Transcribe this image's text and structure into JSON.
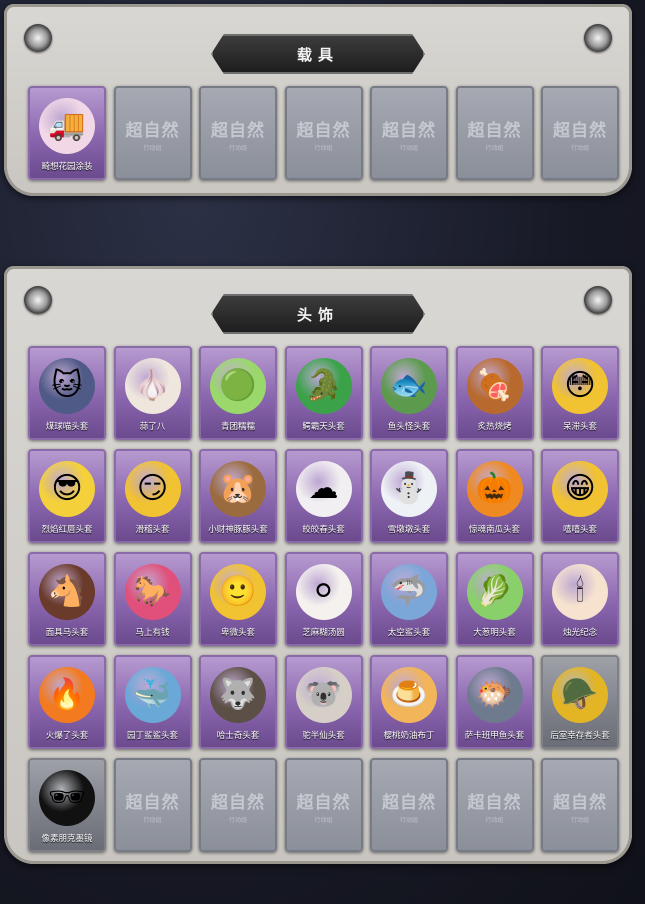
{
  "vehicle_section": {
    "title": "载具",
    "items": [
      {
        "label": "畸想花园涂装",
        "icon": "ice-cream-truck-icon",
        "glyph": "🚚",
        "rarity": "purple",
        "color": "#f2d8e6"
      }
    ],
    "empty_watermark": "超自然",
    "empty_watermark_sub": "行动组",
    "empty_count": 6
  },
  "headwear_section": {
    "title": "头饰",
    "items": [
      {
        "label": "煤球喵头套",
        "icon": "cat-head-icon",
        "glyph": "🐱",
        "rarity": "purple",
        "color": "#505a86"
      },
      {
        "label": "蒜了八",
        "icon": "garlic-head-icon",
        "glyph": "🧄",
        "rarity": "purple",
        "color": "#efe6dd"
      },
      {
        "label": "青团糯糯",
        "icon": "green-dumpling-icon",
        "glyph": "🟢",
        "rarity": "purple",
        "color": "#9ad86b"
      },
      {
        "label": "鳄霸天头套",
        "icon": "crocodile-head-icon",
        "glyph": "🐊",
        "rarity": "purple",
        "color": "#3ba24a"
      },
      {
        "label": "鱼头怪头套",
        "icon": "fish-head-icon",
        "glyph": "🐟",
        "rarity": "purple",
        "color": "#5c9a4e"
      },
      {
        "label": "炙热烧烤",
        "icon": "bbq-head-icon",
        "glyph": "🍖",
        "rarity": "purple",
        "color": "#b86a2e"
      },
      {
        "label": "呆滞头套",
        "icon": "dazed-emoji-icon",
        "glyph": "😳",
        "rarity": "purple",
        "color": "#f1c232"
      },
      {
        "label": "烈焰红唇头套",
        "icon": "pikachu-sunglasses-icon",
        "glyph": "😎",
        "rarity": "purple",
        "color": "#f4d13a"
      },
      {
        "label": "滑稽头套",
        "icon": "funny-emoji-icon",
        "glyph": "😏",
        "rarity": "purple",
        "color": "#f1c232"
      },
      {
        "label": "小财神豚豚头套",
        "icon": "capybara-head-icon",
        "glyph": "🐹",
        "rarity": "purple",
        "color": "#9a6b3e"
      },
      {
        "label": "皎皎春头套",
        "icon": "cloud-face-icon",
        "glyph": "☁",
        "rarity": "purple",
        "color": "#f2eff2"
      },
      {
        "label": "雪墩墩头套",
        "icon": "snowman-head-icon",
        "glyph": "⛄",
        "rarity": "purple",
        "color": "#eef2f6"
      },
      {
        "label": "惊魂南瓜头套",
        "icon": "pumpkin-head-icon",
        "glyph": "🎃",
        "rarity": "purple",
        "color": "#ef8a22"
      },
      {
        "label": "嘻嘻头套",
        "icon": "grin-emoji-icon",
        "glyph": "😁",
        "rarity": "purple",
        "color": "#f1c232"
      },
      {
        "label": "面具马头套",
        "icon": "horse-head-icon",
        "glyph": "🐴",
        "rarity": "purple",
        "color": "#6a3a2a"
      },
      {
        "label": "马上有钱",
        "icon": "pink-horse-head-icon",
        "glyph": "🐎",
        "rarity": "purple",
        "color": "#e0507a"
      },
      {
        "label": "卑微头套",
        "icon": "humble-emoji-icon",
        "glyph": "🙂",
        "rarity": "purple",
        "color": "#f1c232"
      },
      {
        "label": "芝麻糊汤圆",
        "icon": "rice-ball-head-icon",
        "glyph": "⚪",
        "rarity": "purple",
        "color": "#f4f1ee"
      },
      {
        "label": "太空鲨头套",
        "icon": "shark-head-icon",
        "glyph": "🦈",
        "rarity": "purple",
        "color": "#7aa6d8"
      },
      {
        "label": "大葱明头套",
        "icon": "scallion-head-icon",
        "glyph": "🥬",
        "rarity": "purple",
        "color": "#8ad06a"
      },
      {
        "label": "烛光纪念",
        "icon": "candle-head-icon",
        "glyph": "🕯",
        "rarity": "purple",
        "color": "#f6e2cf"
      },
      {
        "label": "火爆了头套",
        "icon": "fire-head-icon",
        "glyph": "🔥",
        "rarity": "purple",
        "color": "#f37a1e"
      },
      {
        "label": "园丁鲨鲨头套",
        "icon": "baby-shark-head-icon",
        "glyph": "🐳",
        "rarity": "purple",
        "color": "#6aa8d8"
      },
      {
        "label": "哈士奇头套",
        "icon": "husky-head-icon",
        "glyph": "🐺",
        "rarity": "purple",
        "color": "#5c5046"
      },
      {
        "label": "驼半仙头套",
        "icon": "koala-head-icon",
        "glyph": "🐨",
        "rarity": "purple",
        "color": "#d6cfc8"
      },
      {
        "label": "樱桃奶油布丁",
        "icon": "pudding-head-icon",
        "glyph": "🍮",
        "rarity": "purple",
        "color": "#f2b55a"
      },
      {
        "label": "萨卡班甲鱼头套",
        "icon": "fish-head-icon",
        "glyph": "🐡",
        "rarity": "purple",
        "color": "#6e7a8e"
      },
      {
        "label": "后室幸存者头套",
        "icon": "gas-mask-helmet-icon",
        "glyph": "🪖",
        "rarity": "gray",
        "color": "#e3b423"
      },
      {
        "label": "像素朋克墨镜",
        "icon": "pixel-sunglasses-icon",
        "glyph": "🕶",
        "rarity": "gray",
        "color": "#111111"
      }
    ],
    "empty_watermark": "超自然",
    "empty_watermark_sub": "行动组",
    "empty_count": 6
  }
}
